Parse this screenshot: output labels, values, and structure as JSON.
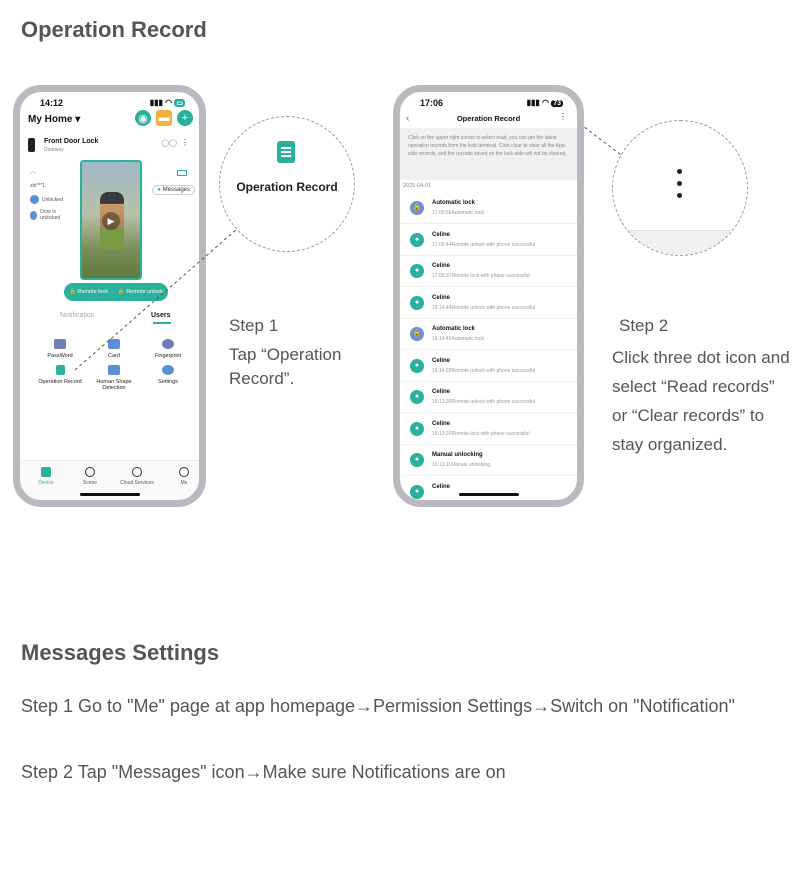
{
  "section1": {
    "title": "Operation Record"
  },
  "phone1": {
    "time": "14:12",
    "home_title": "My Home ▾",
    "lock_name": "Front Door Lock",
    "lock_sub": "Doorway",
    "status_code": "zhi***1",
    "unlocked": "Unlocked",
    "door_unlocked": "Door is unlocked",
    "messages": "Messages",
    "remote_lock": "Remote lock",
    "remote_unlock": "Remote unlock",
    "tab_notification": "Notification",
    "tab_users": "Users",
    "grid": [
      "PassWord",
      "Card",
      "Fingerprint",
      "Operation Record",
      "Human Shape Detection",
      "Settings"
    ],
    "nav": [
      "Device",
      "Scene",
      "Cloud Services",
      "Me"
    ]
  },
  "callout1": {
    "label": "Operation Record"
  },
  "step1": {
    "title": "Step 1",
    "text": "Tap “Operation Record”."
  },
  "phone2": {
    "time": "17:06",
    "battery": "73",
    "header": "Operation Record",
    "info": "Click on the upper right corner to select read, you can get the latest operation records from the lock terminal. Click clear to clear all the App-side records, and the records saved on the lock-side will not be cleared.",
    "date": "2025-04-01",
    "records": [
      {
        "title": "Automatic lock",
        "detail": "17:05:55Automatic lock",
        "type": "lock"
      },
      {
        "title": "Celine",
        "detail": "17:05:44Remote unlock with phone successful",
        "type": "user"
      },
      {
        "title": "Celine",
        "detail": "17:05:37Remote lock with phone successful",
        "type": "user"
      },
      {
        "title": "Celine",
        "detail": "16:14:44Remote unlock with phone successful",
        "type": "user"
      },
      {
        "title": "Automatic lock",
        "detail": "16:14:40Automatic lock",
        "type": "lock"
      },
      {
        "title": "Celine",
        "detail": "16:14:28Remote unlock with phone successful",
        "type": "user"
      },
      {
        "title": "Celine",
        "detail": "16:13:30Remote unlock with phone successful",
        "type": "user"
      },
      {
        "title": "Celine",
        "detail": "16:13:26Remote lock with phone successful",
        "type": "user"
      },
      {
        "title": "Manual unlocking",
        "detail": "16:13:11Manual unlocking",
        "type": "user"
      },
      {
        "title": "Celine",
        "detail": "",
        "type": "user"
      }
    ]
  },
  "step2": {
    "title": "Step 2",
    "text": "Click three dot icon and select “Read records” or “Clear records” to stay organized."
  },
  "section2": {
    "title": "Messages Settings",
    "step1": "Step 1 Go to \"Me\" page at app homepage→Permission Settings→Switch on \"Notification\"",
    "step2": "Step 2 Tap \"Messages\" icon→Make sure Notifications are on"
  }
}
